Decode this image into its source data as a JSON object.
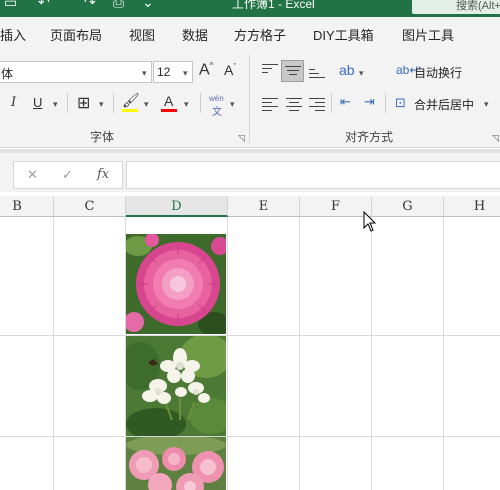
{
  "title_bar": {
    "title": "工作簿1 - Excel",
    "search_label": "搜索(Alt+Q)"
  },
  "tabs": [
    "插入",
    "页面布局",
    "视图",
    "数据",
    "方方格子",
    "DIY工具箱",
    "图片工具"
  ],
  "ribbon": {
    "font_name": "体",
    "font_size": "12",
    "wrap_text_label": "自动换行",
    "merge_center_label": "合并后居中",
    "font_group_label": "字体",
    "align_group_label": "对齐方式",
    "phonetic_top": "wén",
    "phonetic_bottom": "文",
    "grow_font": "A",
    "shrink_font": "A",
    "italic": "I",
    "underline": "U",
    "font_color_glyph": "A",
    "highlight_color": "#ffff00",
    "font_color": "#ff0000"
  },
  "formula_bar": {
    "cancel": "✕",
    "enter": "✓",
    "fx": "fx",
    "value": ""
  },
  "columns": [
    "B",
    "C",
    "D",
    "E",
    "F",
    "G",
    "H"
  ],
  "selected_column": "D",
  "accent_color": "#217346",
  "pictures": [
    "pink-dahlia-photo",
    "white-jasmine-photo",
    "pink-roses-photo"
  ]
}
